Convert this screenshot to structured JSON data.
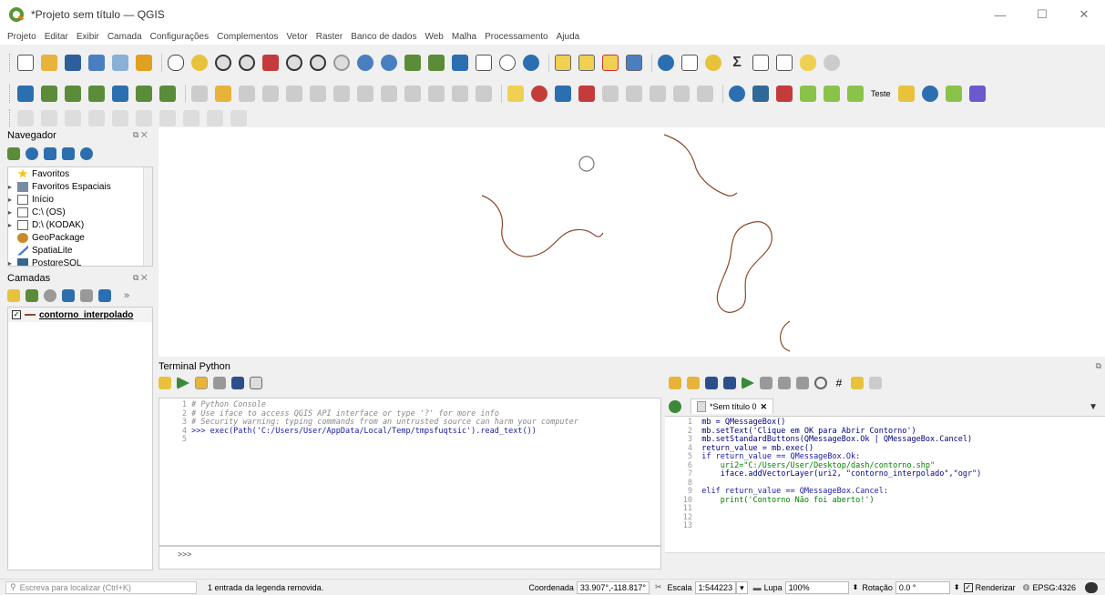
{
  "window": {
    "title": "*Projeto sem título — QGIS",
    "minimize": "—",
    "maximize": "☐",
    "close": "✕"
  },
  "menu": [
    "Projeto",
    "Editar",
    "Exibir",
    "Camada",
    "Configurações",
    "Complementos",
    "Vetor",
    "Raster",
    "Banco de dados",
    "Web",
    "Malha",
    "Processamento",
    "Ajuda"
  ],
  "toolbar_text": {
    "teste": "Teste"
  },
  "navigator": {
    "title": "Navegador",
    "items": [
      {
        "label": "Favoritos",
        "icon": "star-icon",
        "arrow": ""
      },
      {
        "label": "Favoritos Espaciais",
        "icon": "bookmark-icon",
        "arrow": "▸"
      },
      {
        "label": "Início",
        "icon": "home-folder-icon",
        "arrow": "▸"
      },
      {
        "label": "C:\\ (OS)",
        "icon": "folder-icon",
        "arrow": "▸"
      },
      {
        "label": "D:\\ (KODAK)",
        "icon": "folder-icon",
        "arrow": "▸"
      },
      {
        "label": "GeoPackage",
        "icon": "geopackage-icon",
        "arrow": ""
      },
      {
        "label": "SpatiaLite",
        "icon": "spatialite-icon",
        "arrow": ""
      },
      {
        "label": "PostgreSQL",
        "icon": "postgresql-icon",
        "arrow": "▸"
      }
    ]
  },
  "layers": {
    "title": "Camadas",
    "more": "»",
    "items": [
      {
        "label": "contorno_interpolado",
        "checked": true
      }
    ]
  },
  "python": {
    "title": "Terminal Python",
    "console_lines": [
      {
        "n": "1",
        "text": "# Python Console"
      },
      {
        "n": "2",
        "text": "# Use iface to access QGIS API interface or type '?' for more info"
      },
      {
        "n": "3",
        "text": "# Security warning: typing commands from an untrusted source can harm your computer"
      },
      {
        "n": "4",
        "text": ">>> exec(Path('C:/Users/User/AppData/Local/Temp/tmpsfuqtsic').read_text())"
      },
      {
        "n": "5",
        "text": ""
      }
    ],
    "prompt": ">>>",
    "tab_label": "*Sem título 0",
    "tab_close": "✕",
    "editor_lines": [
      {
        "n": "1",
        "text": "mb = QMessageBox()"
      },
      {
        "n": "2",
        "text": "mb.setText('Clique em OK para Abrir Contorno')"
      },
      {
        "n": "3",
        "text": "mb.setStandardButtons(QMessageBox.Ok | QMessageBox.Cancel)"
      },
      {
        "n": "4",
        "text": "return_value = mb.exec()"
      },
      {
        "n": "5",
        "text": "if return_value == QMessageBox.Ok:"
      },
      {
        "n": "6",
        "text": "    uri2=\"C:/Users/User/Desktop/dash/contorno.shp\""
      },
      {
        "n": "7",
        "text": "    iface.addVectorLayer(uri2, \"contorno_interpolado\",\"ogr\")"
      },
      {
        "n": "8",
        "text": ""
      },
      {
        "n": "9",
        "text": "elif return_value == QMessageBox.Cancel:"
      },
      {
        "n": "10",
        "text": "    print('Contorno Não foi aberto!')"
      },
      {
        "n": "11",
        "text": ""
      },
      {
        "n": "12",
        "text": ""
      },
      {
        "n": "13",
        "text": ""
      }
    ]
  },
  "status": {
    "search_placeholder": "Escreva para localizar (Ctrl+K)",
    "message": "1 entrada da legenda removida.",
    "coord_label": "Coordenada",
    "coord_value": "33.907°,-118.817°",
    "scale_label": "Escala",
    "scale_value": "1:544223",
    "lupa_label": "Lupa",
    "lupa_value": "100%",
    "rot_label": "Rotação",
    "rot_value": "0.0 °",
    "render_label": "Renderizar",
    "crs": "EPSG:4326"
  },
  "colors": {
    "contour": "#8b4a2b",
    "accent": "#589632"
  }
}
